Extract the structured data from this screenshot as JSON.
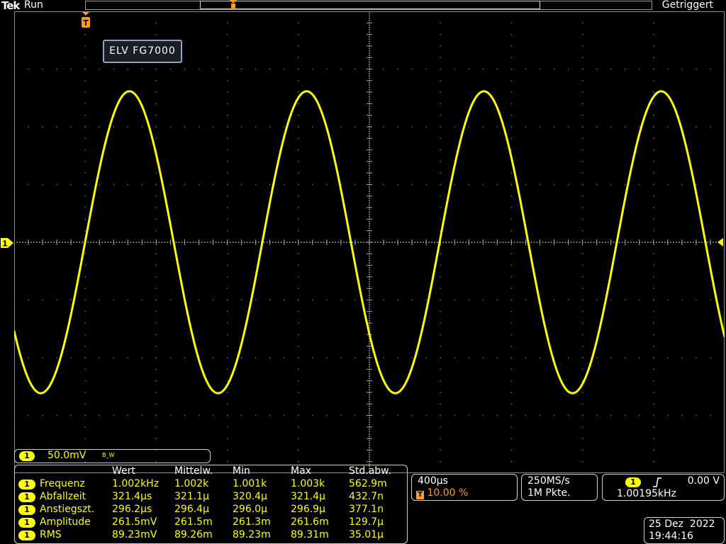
{
  "header": {
    "brand": "Tek",
    "run_state": "Run",
    "trigger_state": "Getriggert"
  },
  "waveform_label": "ELV FG7000",
  "channel": {
    "number": "1",
    "scale": "50.0mV",
    "bw_icon": "B_W",
    "color": "#ffff00"
  },
  "chart_data": {
    "type": "line",
    "x_unit": "s",
    "y_unit": "V",
    "x_range": [
      -0.002,
      0.002
    ],
    "y_range": [
      -0.2,
      0.2
    ],
    "signal": {
      "shape": "sine",
      "frequency_hz": 1001.95,
      "amplitude_pp_v": 0.2615,
      "offset_v": 0,
      "phase_at_left_deg": 216
    }
  },
  "measurements": {
    "headers": [
      "Wert",
      "Mittelw.",
      "Min",
      "Max",
      "Std.abw."
    ],
    "rows": [
      {
        "ch": "1",
        "name": "Frequenz",
        "wert": "1.002kHz",
        "mittel": "1.002k",
        "min": "1.001k",
        "max": "1.003k",
        "std": "562.9m"
      },
      {
        "ch": "1",
        "name": "Abfallzeit",
        "wert": "321.4µs",
        "mittel": "321.1µ",
        "min": "320.4µ",
        "max": "321.4µ",
        "std": "432.7n"
      },
      {
        "ch": "1",
        "name": "Anstiegszt.",
        "wert": "296.2µs",
        "mittel": "296.4µ",
        "min": "296.0µ",
        "max": "296.9µ",
        "std": "377.1n"
      },
      {
        "ch": "1",
        "name": "Amplitude",
        "wert": "261.5mV",
        "mittel": "261.5m",
        "min": "261.3m",
        "max": "261.6m",
        "std": "129.7µ"
      },
      {
        "ch": "1",
        "name": "RMS",
        "wert": "89.23mV",
        "mittel": "89.26m",
        "min": "89.23m",
        "max": "89.31m",
        "std": "35.01µ"
      }
    ]
  },
  "horizontal": {
    "scale": "400µs",
    "trigger_badge": "T",
    "position": "10.00 %"
  },
  "acquisition": {
    "sample_rate": "250MS/s",
    "record_length": "1M Pkte."
  },
  "trigger": {
    "source": "1",
    "slope_icon": "rising-edge",
    "level": "0.00 V",
    "frequency": "1.00195kHz"
  },
  "datetime": {
    "date": "25 Dez  2022",
    "time": "19:44:16"
  }
}
